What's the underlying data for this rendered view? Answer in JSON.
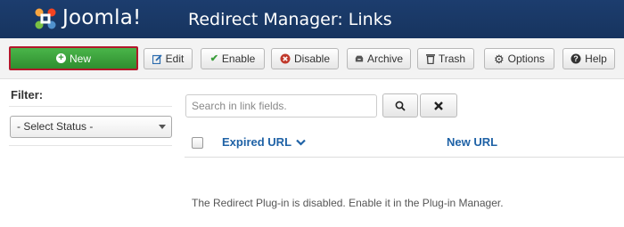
{
  "header": {
    "logo_text": "Joomla!",
    "title": "Redirect Manager: Links"
  },
  "toolbar": {
    "buttons": [
      {
        "label": "New",
        "icon": "plus-circle-icon"
      },
      {
        "label": "Edit",
        "icon": "edit-icon"
      },
      {
        "label": "Enable",
        "icon": "check-icon"
      },
      {
        "label": "Disable",
        "icon": "remove-circle-icon"
      },
      {
        "label": "Archive",
        "icon": "archive-icon"
      },
      {
        "label": "Trash",
        "icon": "trash-icon"
      },
      {
        "label": "Options",
        "icon": "gear-icon"
      },
      {
        "label": "Help",
        "icon": "question-icon"
      }
    ]
  },
  "sidebar": {
    "filter_label": "Filter:",
    "status_select": "- Select Status -"
  },
  "search": {
    "placeholder": "Search in link fields."
  },
  "table": {
    "columns": [
      "Expired URL",
      "New URL"
    ]
  },
  "message": "The Redirect Plug-in is disabled. Enable it in the Plug-in Manager.",
  "colors": {
    "header_bg": "#1a3867",
    "new_button": "#3a9d3a",
    "new_button_border": "#b2182b",
    "link": "#1f62a6"
  }
}
